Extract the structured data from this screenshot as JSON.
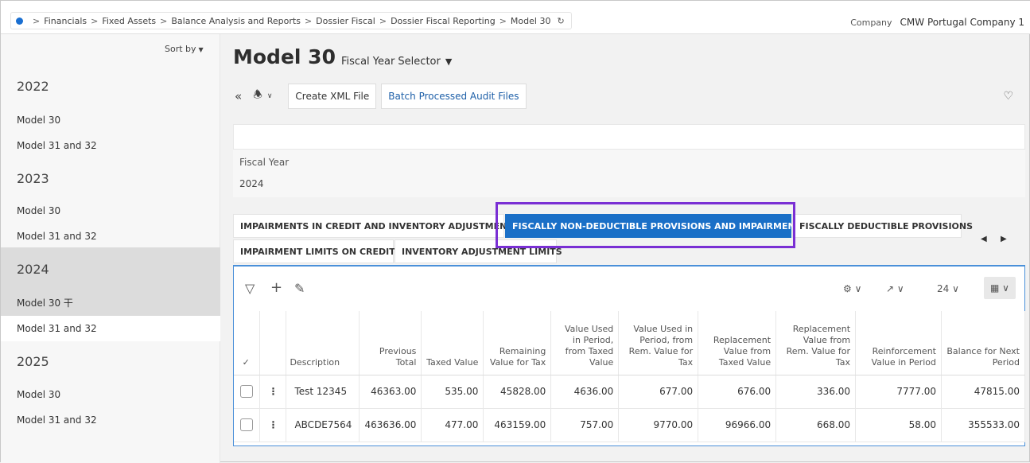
{
  "breadcrumb": [
    "Financials",
    "Fixed Assets",
    "Balance Analysis and Reports",
    "Dossier Fiscal",
    "Dossier Fiscal Reporting",
    "Model 30"
  ],
  "company": {
    "label": "Company",
    "value": "CMW Portugal Company 1"
  },
  "sidebar": {
    "sort_label": "Sort by",
    "groups": [
      {
        "year": "2022",
        "items": [
          "Model 30",
          "Model 31 and 32"
        ]
      },
      {
        "year": "2023",
        "items": [
          "Model 30",
          "Model 31 and 32"
        ]
      },
      {
        "year": "2024",
        "items": [
          "Model 30 干",
          "Model 31 and 32"
        ]
      },
      {
        "year": "2025",
        "items": [
          "Model 30",
          "Model 31 and 32"
        ]
      }
    ]
  },
  "page": {
    "title": "Model 30",
    "selector": "Fiscal Year Selector"
  },
  "toolbar": {
    "create_xml": "Create XML File",
    "batch": "Batch Processed Audit Files"
  },
  "fiscal_year": {
    "label": "Fiscal Year",
    "value": "2024"
  },
  "tabs": [
    "IMPAIRMENTS IN CREDIT AND INVENTORY ADJUSTMENTS",
    "FISCALLY NON-DEDUCTIBLE PROVISIONS AND IMPAIRMENTS",
    "FISCALLY DEDUCTIBLE PROVISIONS",
    "IMPAIRMENT LIMITS ON CREDITS",
    "INVENTORY ADJUSTMENT LIMITS"
  ],
  "grid": {
    "page_size": "24",
    "columns": [
      "Description",
      "Previous Total",
      "Taxed Value",
      "Remaining Value for Tax",
      "Value Used in Period, from Taxed Value",
      "Value Used in Period, from Rem. Value for Tax",
      "Replacement Value from Taxed Value",
      "Replacement Value from Rem. Value for Tax",
      "Reinforcement Value in Period",
      "Balance for Next Period"
    ],
    "rows": [
      [
        "Test 12345",
        "46363.00",
        "535.00",
        "45828.00",
        "4636.00",
        "677.00",
        "676.00",
        "336.00",
        "7777.00",
        "47815.00"
      ],
      [
        "ABCDE7564",
        "463636.00",
        "477.00",
        "463159.00",
        "757.00",
        "9770.00",
        "96966.00",
        "668.00",
        "58.00",
        "355533.00"
      ]
    ]
  }
}
